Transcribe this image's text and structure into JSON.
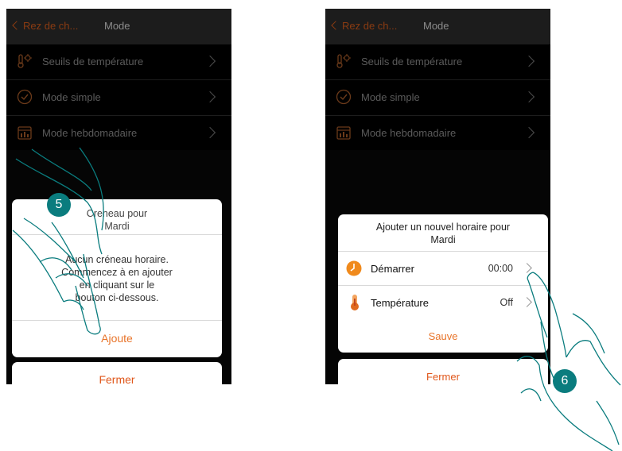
{
  "header": {
    "back_label": "Rez de ch...",
    "title": "Mode"
  },
  "menu": [
    {
      "label": "Seuils de  température",
      "icon": "thermometer-icon"
    },
    {
      "label": "Mode simple",
      "icon": "check-circle-icon"
    },
    {
      "label": "Mode hebdomadaire",
      "icon": "weekly-calendar-icon"
    }
  ],
  "left_dialog": {
    "title_line1": "Creneau pour",
    "title_line2": "Mardi",
    "message_line1": "Aucun créneau horaire.",
    "message_line2": "Commencez à en ajouter",
    "message_line3": "en cliquant sur le",
    "message_line4": "bouton ci-dessous.",
    "add_label": "Ajoute",
    "close_label": "Fermer"
  },
  "right_dialog": {
    "title_line1": "Ajouter un nouvel horaire pour",
    "title_line2": "Mardi",
    "start_label": "Démarrer",
    "start_value": "00:00",
    "temp_label": "Température",
    "temp_value": "Off",
    "save_label": "Sauve",
    "close_label": "Fermer"
  },
  "steps": {
    "left": "5",
    "right": "6"
  },
  "colors": {
    "accent": "#e8742a",
    "badge": "#0a7c7e"
  }
}
